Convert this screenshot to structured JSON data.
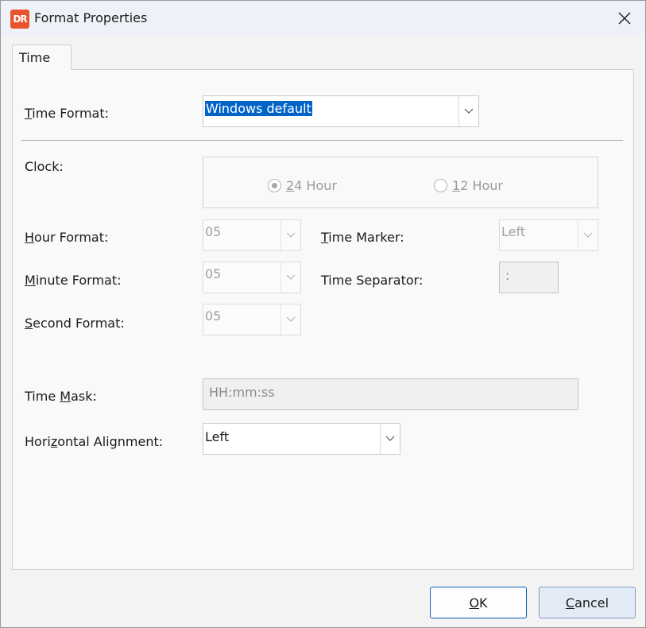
{
  "window": {
    "title": "Format Properties",
    "logo_text": "DR"
  },
  "tabs": [
    {
      "label": "Time"
    }
  ],
  "form": {
    "time_format": {
      "label_pre": "",
      "label_key": "T",
      "label_post": "ime Format:",
      "value": "Windows default"
    },
    "clock": {
      "label": "Clock:",
      "option_24": {
        "key": "2",
        "rest": "4 Hour",
        "selected": true
      },
      "option_12": {
        "key": "1",
        "rest": "2 Hour",
        "selected": false
      }
    },
    "hour_format": {
      "label_pre": "",
      "label_key": "H",
      "label_post": "our Format:",
      "value": "05"
    },
    "minute_format": {
      "label_pre": "",
      "label_key": "M",
      "label_post": "inute Format:",
      "value": "05"
    },
    "second_format": {
      "label_pre": "",
      "label_key": "S",
      "label_post": "econd Format:",
      "value": "05"
    },
    "time_marker": {
      "label_pre": "",
      "label_key": "T",
      "label_post": "ime Marker:",
      "value": "Left"
    },
    "time_separator": {
      "label": "Time Separator:",
      "value": ":"
    },
    "time_mask": {
      "label_pre": "Time ",
      "label_key": "M",
      "label_post": "ask:",
      "value": "HH:mm:ss"
    },
    "horizontal_alignment": {
      "label_pre": "Hori",
      "label_key": "z",
      "label_post": "ontal Alignment:",
      "value": "Left"
    }
  },
  "buttons": {
    "ok": {
      "key": "O",
      "rest": "K"
    },
    "cancel": {
      "key": "C",
      "rest": "ancel"
    }
  }
}
